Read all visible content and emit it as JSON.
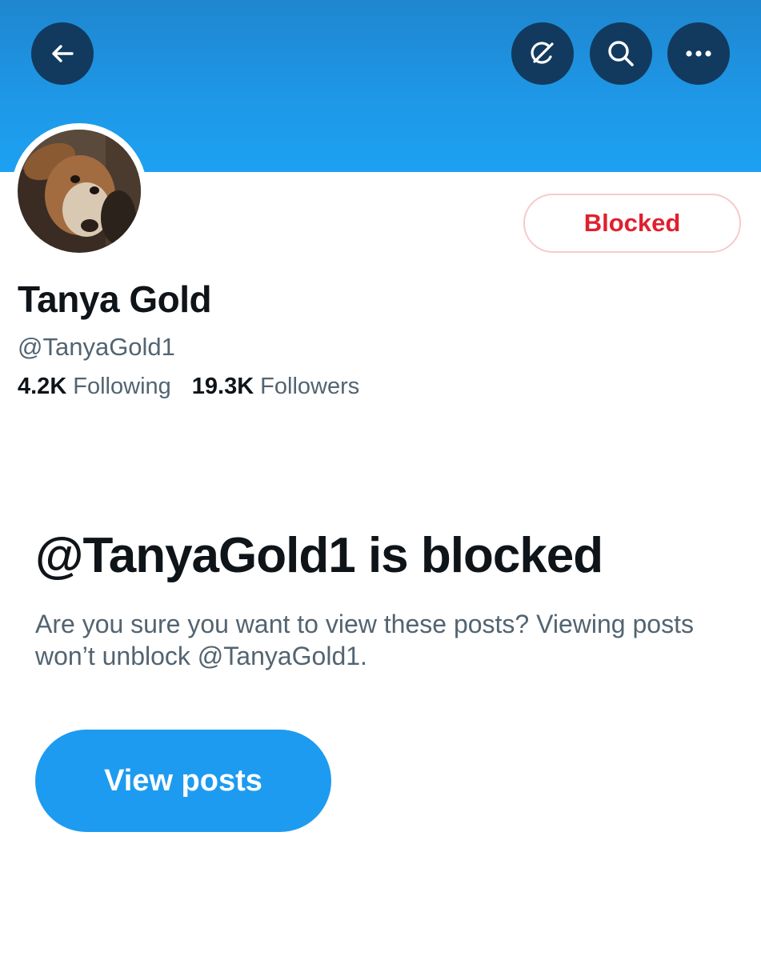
{
  "header": {
    "back_icon": "arrow-left-icon",
    "grok_icon": "grok-icon",
    "search_icon": "search-icon",
    "more_icon": "more-icon",
    "banner_color": "#1d9bf0",
    "button_color": "#123a5e"
  },
  "profile": {
    "avatar_desc": "dog photo",
    "display_name": "Tanya Gold",
    "handle": "@TanyaGold1",
    "following_count": "4.2K",
    "following_label": "Following",
    "followers_count": "19.3K",
    "followers_label": "Followers",
    "blocked_button_label": "Blocked",
    "blocked_color": "#e0202e"
  },
  "blocked_notice": {
    "title": "@TanyaGold1 is blocked",
    "description": "Are you sure you want to view these posts? Viewing posts won’t unblock @TanyaGold1.",
    "view_posts_label": "View posts",
    "accent": "#1d9bf0"
  }
}
